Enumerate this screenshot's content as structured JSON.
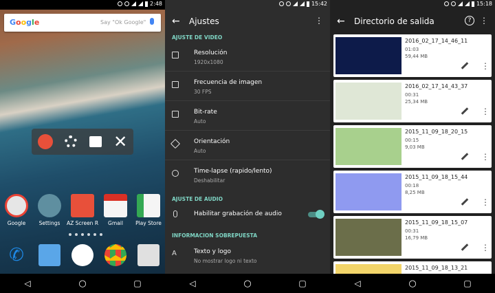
{
  "screen1": {
    "status_time": "2:48",
    "search_logo": "Google",
    "search_hint": "Say \"Ok Google\"",
    "apps": [
      {
        "label": "Google",
        "color": "#d9d9d9"
      },
      {
        "label": "Settings",
        "color": "#5f8fa0"
      },
      {
        "label": "AZ Screen R...",
        "color": "#e8503a"
      },
      {
        "label": "Gmail",
        "color": "#f2f2f2"
      },
      {
        "label": "Play Store",
        "color": "#f2f2f2"
      }
    ],
    "dock": [
      {
        "name": "phone-icon",
        "color": "#1e88e5"
      },
      {
        "name": "messages-icon",
        "color": "#64b5f6"
      },
      {
        "name": "app-drawer-icon",
        "color": "#ffffff"
      },
      {
        "name": "chrome-icon",
        "color": "#f4c20d"
      },
      {
        "name": "camera-icon",
        "color": "#e0e0e0"
      }
    ]
  },
  "screen2": {
    "status_time": "15:42",
    "title": "Ajustes",
    "sections": {
      "video": "AJUSTE DE VIDEO",
      "audio": "AJUSTE DE AUDIO",
      "overlay": "INFORMACION SOBREPUESTA"
    },
    "video_rows": [
      {
        "title": "Resolución",
        "sub": "1920x1080"
      },
      {
        "title": "Frecuencia de imagen",
        "sub": "30 FPS"
      },
      {
        "title": "Bit-rate",
        "sub": "Auto"
      },
      {
        "title": "Orientación",
        "sub": "Auto"
      },
      {
        "title": "Time-lapse (rapido/lento)",
        "sub": "Deshabilitar"
      }
    ],
    "audio_row": {
      "title": "Habilitar grabación de audio",
      "enabled": true
    },
    "overlay_row": {
      "title": "Texto y logo",
      "sub": "No mostrar logo ni texto"
    }
  },
  "screen3": {
    "status_time": "15:18",
    "title": "Directorio de salida",
    "videos": [
      {
        "name": "2016_02_17_14_46_11",
        "duration": "01:03",
        "size": "59,44 MB",
        "thumb": "#0d1b4a"
      },
      {
        "name": "2016_02_17_14_43_37",
        "duration": "00:31",
        "size": "25,34 MB",
        "thumb": "#dfe7d6"
      },
      {
        "name": "2015_11_09_18_20_15",
        "duration": "00:15",
        "size": "9,03 MB",
        "thumb": "#a8d08d"
      },
      {
        "name": "2015_11_09_18_15_44",
        "duration": "00:18",
        "size": "8,25 MB",
        "thumb": "#8f9af0"
      },
      {
        "name": "2015_11_09_18_15_07",
        "duration": "00:31",
        "size": "16,79 MB",
        "thumb": "#6b6e4a"
      },
      {
        "name": "2015_11_09_18_13_21",
        "duration": "",
        "size": "",
        "thumb": "#f3d56a"
      }
    ]
  }
}
